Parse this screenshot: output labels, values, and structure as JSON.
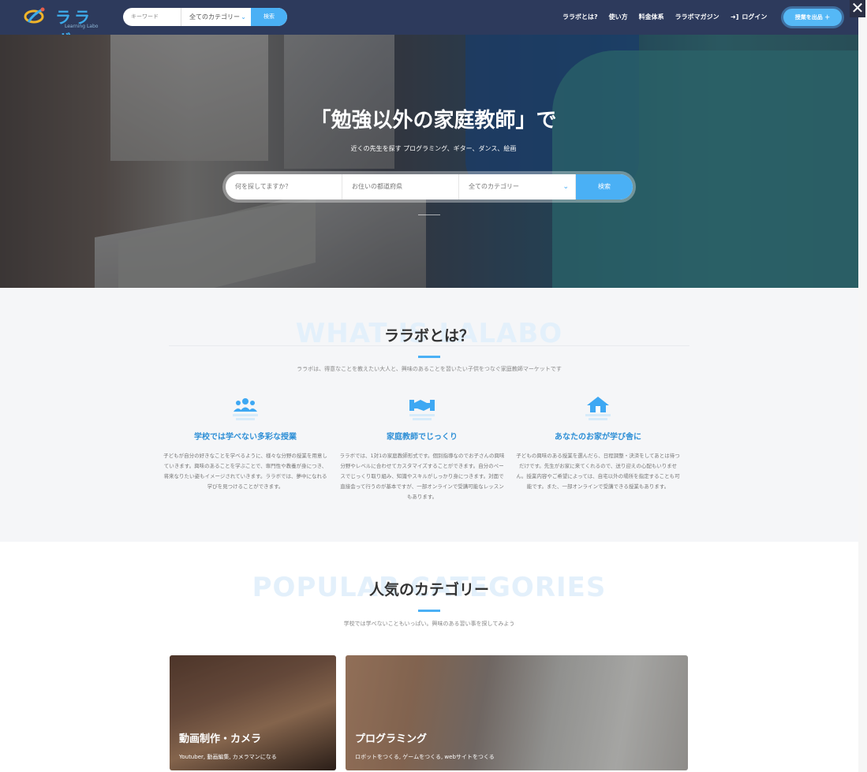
{
  "header": {
    "logo_text": "ララボ",
    "logo_sub": "Learning Labo",
    "search_placeholder": "キーワード",
    "category_select": "全てのカテゴリー",
    "search_button": "検索",
    "nav": [
      "ララボとは?",
      "使い方",
      "料金体系",
      "ララボマガジン"
    ],
    "login": "ログイン",
    "post_button": "授業を出品 ＋",
    "close": "✕"
  },
  "hero": {
    "title": "「勉強以外の家庭教師」で",
    "subtitle": "近くの先生を探す プログラミング、ギター、ダンス、絵画",
    "search_placeholder": "何を探してますか？",
    "location_placeholder": "お住いの都道府県",
    "category_select": "全てのカテゴリー",
    "search_button": "検索"
  },
  "what": {
    "ghost": "WHAT IS LALABO",
    "title": "ララボとは？",
    "desc": "ララボは、得意なことを教えたい大人と、興味のあることを習いたい子供をつなぐ家庭教師マーケットです",
    "features": [
      {
        "icon": "people-icon",
        "title": "学校では学べない多彩な授業",
        "text": "子どもが自分の好きなことを学べるように、様々な分野の授業を用意していきます。興味のあることを学ぶことで、専門性や教養が身につき、将来なりたい姿もイメージされていきます。ララボでは、夢中になれる学びを見つけることができます。"
      },
      {
        "icon": "handshake-icon",
        "title": "家庭教師でじっくり",
        "text": "ララボでは、1対1の家庭教師形式です。個別指導なのでお子さんの興味分野やレベルに合わせてカスタマイズすることができます。自分のペースでじっくり取り組み、知識やスキルがしっかり身につきます。対面で直接会って行うのが基本ですが、一部オンラインで受講可能なレッスンもあります。"
      },
      {
        "icon": "house-icon",
        "title": "あなたのお家が学び舎に",
        "text": "子どもの興味のある授業を選んだら、日程調整・決済をしてあとは待つだけです。先生がお家に来てくれるので、送り迎えの心配もいりません。授業内容やご希望によっては、自宅以外の場所を指定することも可能です。また、一部オンラインで受講できる授業もあります。"
      }
    ]
  },
  "categories": {
    "ghost": "POPULAR CATEGORIES",
    "title": "人気のカテゴリー",
    "desc": "学校では学べないこともいっぱい。興味のある習い事を探してみよう",
    "cards": [
      {
        "title": "動画制作・カメラ",
        "desc": "Youtuber, 動画編集, カメラマンになる"
      },
      {
        "title": "プログラミング",
        "desc": "ロボットをつくる, ゲームをつくる, webサイトをつくる"
      }
    ]
  }
}
